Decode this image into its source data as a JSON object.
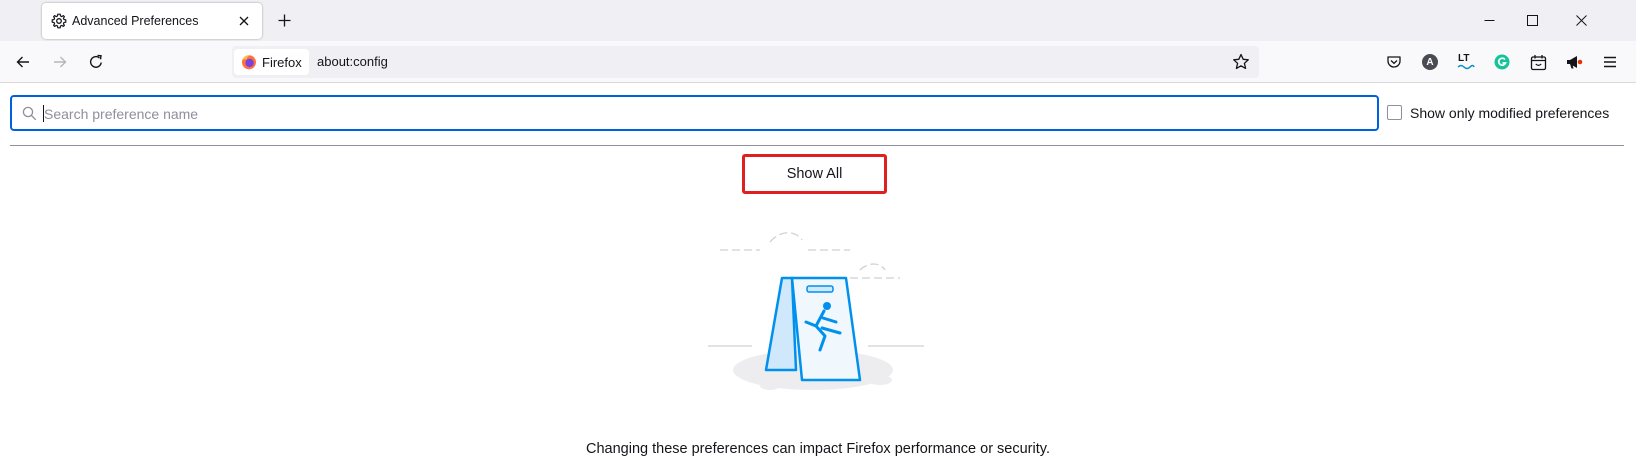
{
  "tab": {
    "title": "Advanced Preferences"
  },
  "urlbar": {
    "identity_label": "Firefox",
    "url": "about:config"
  },
  "toolbar": {
    "icons": [
      "pocket-icon",
      "account-a-icon",
      "languagetool-icon",
      "grammarly-icon",
      "calendar-extension-icon",
      "megaphone-icon",
      "menu-icon"
    ],
    "account_letter": "A",
    "languagetool_letters": "LT"
  },
  "search": {
    "placeholder": "Search preference name",
    "value": ""
  },
  "modified_filter": {
    "label": "Show only modified preferences",
    "checked": false
  },
  "show_all": {
    "label": "Show All"
  },
  "warning": {
    "text": "Changing these preferences can impact Firefox performance or security."
  },
  "colors": {
    "focus": "#0061e0",
    "highlight_border": "#e02020",
    "illustration": "#0090ed"
  }
}
